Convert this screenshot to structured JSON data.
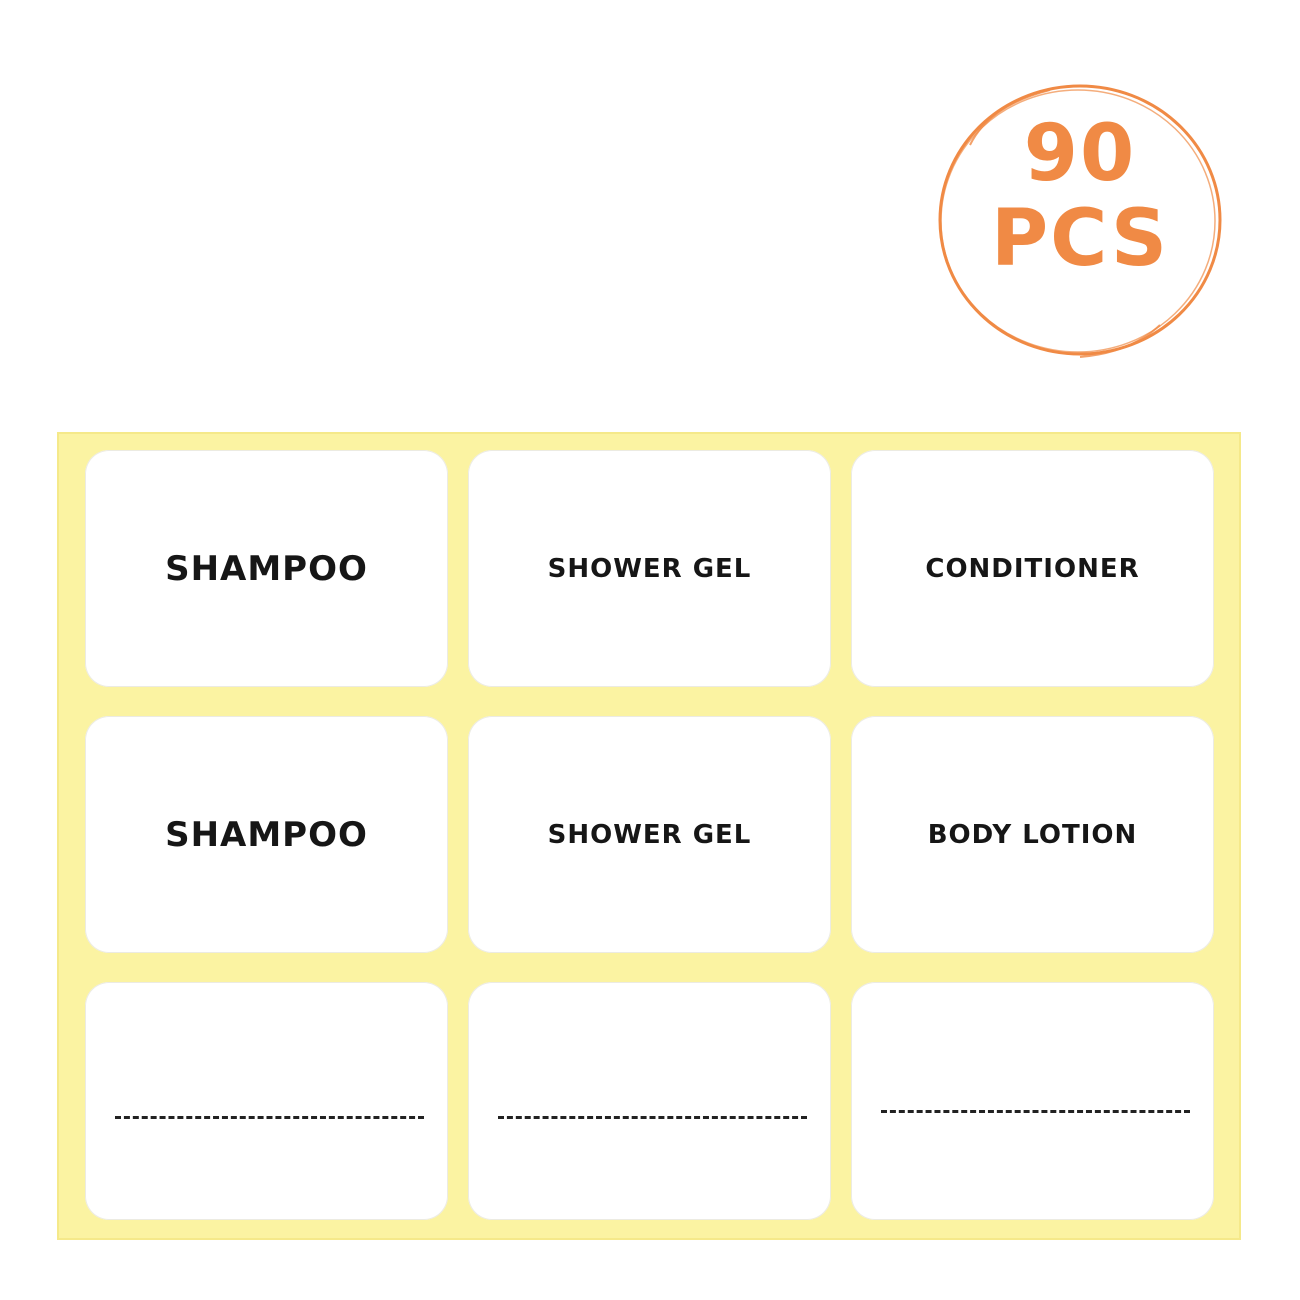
{
  "badge": {
    "count": "90",
    "unit": "PCS",
    "color": "#F08A45"
  },
  "sheet": {
    "background_color": "#FBF3A2",
    "stickers": [
      {
        "label": "SHAMPOO"
      },
      {
        "label": "SHOWER GEL"
      },
      {
        "label": "CONDITIONER"
      },
      {
        "label": "SHAMPOO"
      },
      {
        "label": "SHOWER GEL"
      },
      {
        "label": "BODY LOTION"
      },
      {
        "label": "",
        "blank": true
      },
      {
        "label": "",
        "blank": true
      },
      {
        "label": "",
        "blank": true
      }
    ]
  }
}
